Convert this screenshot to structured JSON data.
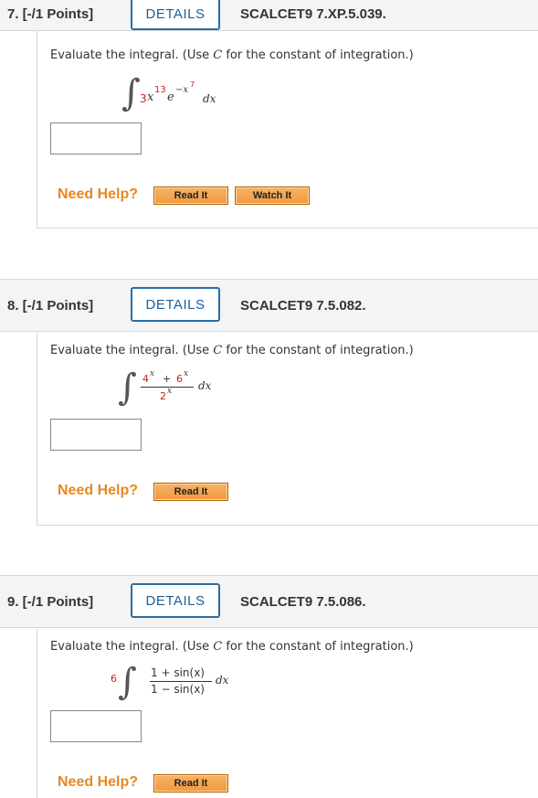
{
  "questions": [
    {
      "number": "7. [-/1 Points]",
      "details_label": "DETAILS",
      "code": "SCALCET9 7.XP.5.039.",
      "prompt_text": "Evaluate the integral. (Use ",
      "prompt_var": "C",
      "prompt_end": " for the constant of integration.)",
      "integrand": {
        "coef": "3",
        "var": "x",
        "exp": "13",
        "e": "e",
        "exp2": "−x",
        "exp2sup": "7",
        "dx": "dx"
      },
      "answer_value": "",
      "help_label": "Need Help?",
      "buttons": [
        "Read It",
        "Watch It"
      ]
    },
    {
      "number": "8. [-/1 Points]",
      "details_label": "DETAILS",
      "code": "SCALCET9 7.5.082.",
      "prompt_text": "Evaluate the integral. (Use ",
      "prompt_var": "C",
      "prompt_end": " for the constant of integration.)",
      "integrand": {
        "num_a": "4",
        "num_b": "6",
        "sup": "x",
        "plus": "+",
        "den": "2",
        "dx": "dx"
      },
      "answer_value": "",
      "help_label": "Need Help?",
      "buttons": [
        "Read It"
      ]
    },
    {
      "number": "9. [-/1 Points]",
      "details_label": "DETAILS",
      "code": "SCALCET9 7.5.086.",
      "prompt_text": "Evaluate the integral. (Use ",
      "prompt_var": "C",
      "prompt_end": " for the constant of integration.)",
      "integrand": {
        "upper": "6",
        "num": "1 + sin(x)",
        "den": "1 − sin(x)",
        "dx": "dx"
      },
      "answer_value": "",
      "help_label": "Need Help?",
      "buttons": [
        "Read It"
      ]
    }
  ]
}
